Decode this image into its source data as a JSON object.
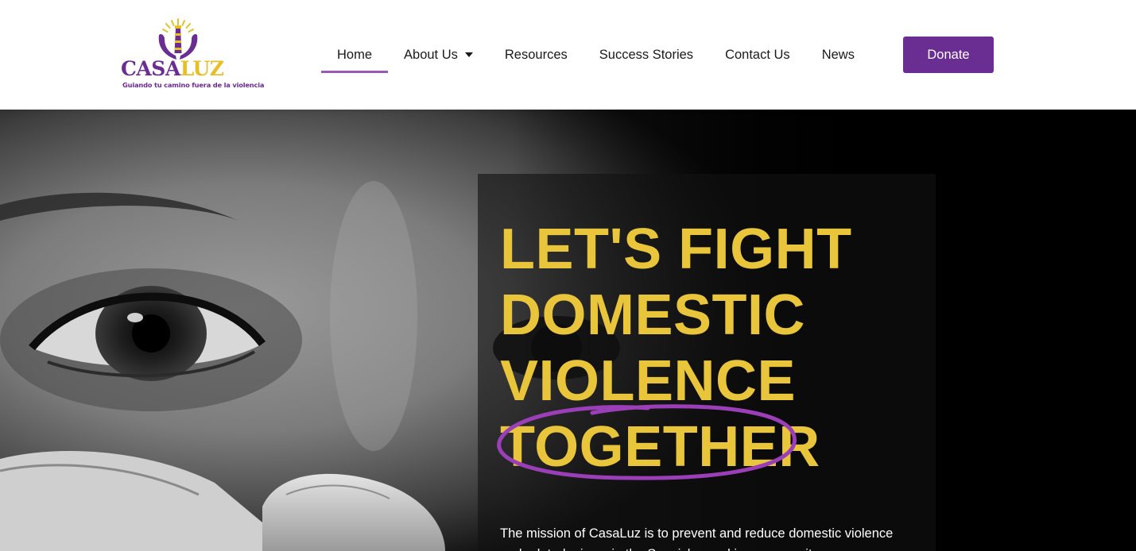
{
  "brand": {
    "name_part1": "CASA",
    "name_part2": "LUZ",
    "tagline": "Guiando tu camino fuera de la violencia",
    "colors": {
      "purple": "#6a2d91",
      "yellow": "#e6c026"
    }
  },
  "nav": {
    "items": [
      {
        "label": "Home",
        "active": true
      },
      {
        "label": "About Us",
        "has_dropdown": true
      },
      {
        "label": "Resources"
      },
      {
        "label": "Success Stories"
      },
      {
        "label": "Contact Us"
      },
      {
        "label": "News"
      }
    ],
    "donate_label": "Donate",
    "active_underline_color": "#9b59b6"
  },
  "hero": {
    "headline": [
      "LET'S FIGHT",
      "DOMESTIC",
      "VIOLENCE",
      "TOGETHER"
    ],
    "headline_color": "#e8c53a",
    "circled_word_color": "#9b3fb8",
    "mission": "The mission of CasaLuz is to prevent and reduce domestic violence and related crimes in the Spanish-speaking community"
  }
}
